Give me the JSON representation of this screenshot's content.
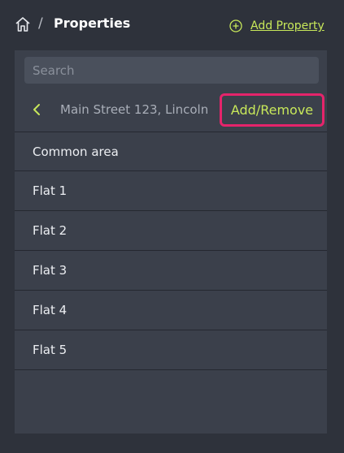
{
  "header": {
    "breadcrumb_separator": "/",
    "title": "Properties",
    "add_property_label": "Add Property",
    "accent_color": "#c8e85a"
  },
  "panel": {
    "search_placeholder": "Search",
    "address": "Main Street 123, Lincoln",
    "add_remove_label": "Add/Remove",
    "highlight_color": "#e5246b",
    "items": [
      "Common area",
      "Flat 1",
      "Flat 2",
      "Flat 3",
      "Flat 4",
      "Flat 5"
    ]
  },
  "icons": {
    "home": "home-icon",
    "add": "plus-circle-icon",
    "back": "chevron-left-icon"
  }
}
